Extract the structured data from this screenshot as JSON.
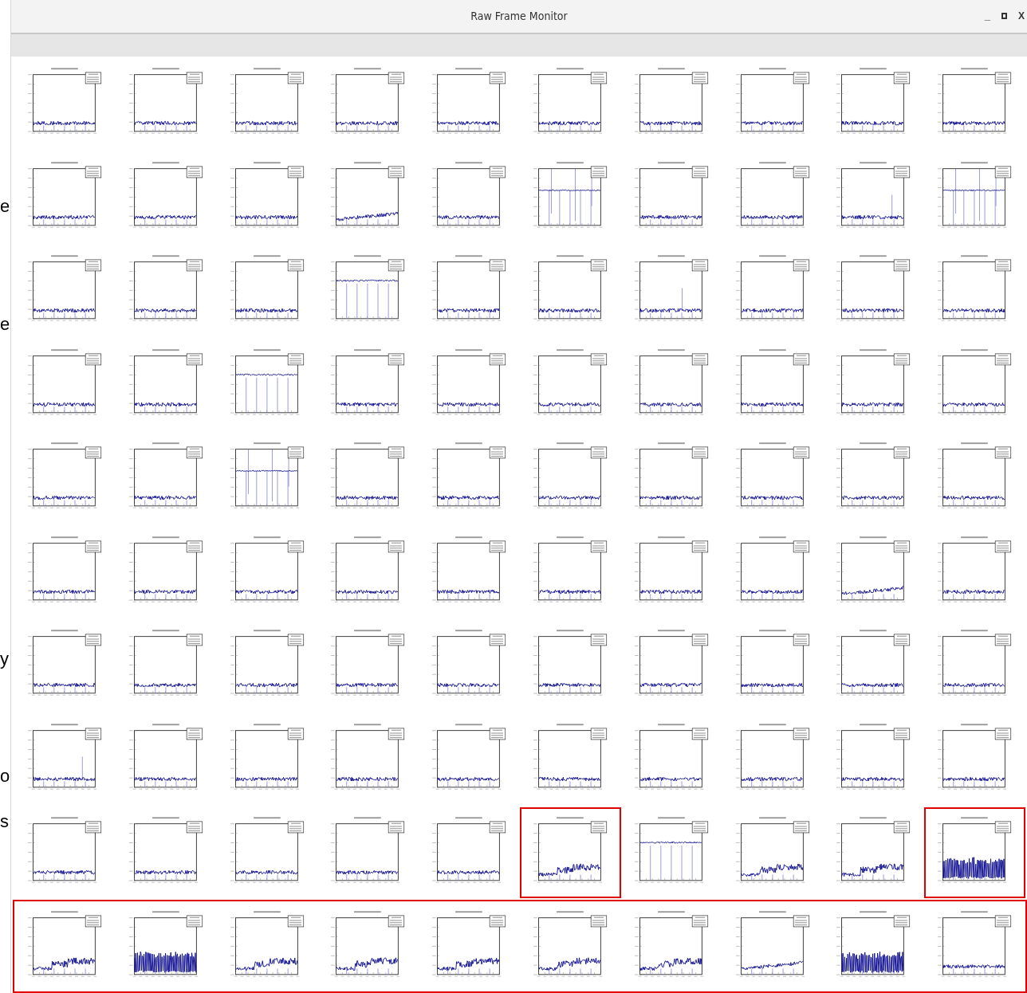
{
  "background_text": [
    {
      "text": "e"
    },
    {
      "text": "e"
    },
    {
      "text": "y"
    },
    {
      "text": "o"
    },
    {
      "text": "s"
    }
  ],
  "window": {
    "title": "Raw Frame Monitor",
    "controls": [
      {
        "kind": "minimize",
        "label": "_"
      },
      {
        "kind": "maximize"
      },
      {
        "kind": "close",
        "label": "X"
      }
    ]
  },
  "plots": {
    "rows": [
      {
        "highlighted": false,
        "cells": [
          {
            "kind": "flat",
            "highlighted": false
          },
          {
            "kind": "flat",
            "highlighted": false
          },
          {
            "kind": "flat",
            "highlighted": false
          },
          {
            "kind": "flat",
            "highlighted": false
          },
          {
            "kind": "flat",
            "highlighted": false
          },
          {
            "kind": "flat",
            "highlighted": false
          },
          {
            "kind": "flat",
            "highlighted": false
          },
          {
            "kind": "flat",
            "highlighted": false
          },
          {
            "kind": "flat",
            "highlighted": false
          },
          {
            "kind": "flat",
            "highlighted": false
          }
        ]
      },
      {
        "highlighted": false,
        "cells": [
          {
            "kind": "flat",
            "highlighted": false
          },
          {
            "kind": "flat",
            "highlighted": false
          },
          {
            "kind": "flat",
            "highlighted": false
          },
          {
            "kind": "ramp",
            "highlighted": false
          },
          {
            "kind": "flat",
            "highlighted": false
          },
          {
            "kind": "dips",
            "highlighted": false
          },
          {
            "kind": "flat",
            "highlighted": false
          },
          {
            "kind": "flat",
            "highlighted": false
          },
          {
            "kind": "spike",
            "highlighted": false
          },
          {
            "kind": "dips",
            "highlighted": false
          }
        ]
      },
      {
        "highlighted": false,
        "cells": [
          {
            "kind": "flat",
            "highlighted": false
          },
          {
            "kind": "flat",
            "highlighted": false
          },
          {
            "kind": "flat",
            "highlighted": false
          },
          {
            "kind": "high",
            "highlighted": false
          },
          {
            "kind": "flat",
            "highlighted": false
          },
          {
            "kind": "flat",
            "highlighted": false
          },
          {
            "kind": "spike",
            "highlighted": false
          },
          {
            "kind": "flat",
            "highlighted": false
          },
          {
            "kind": "flat",
            "highlighted": false
          },
          {
            "kind": "flat",
            "highlighted": false
          }
        ]
      },
      {
        "highlighted": false,
        "cells": [
          {
            "kind": "flat",
            "highlighted": false
          },
          {
            "kind": "flat",
            "highlighted": false
          },
          {
            "kind": "high",
            "highlighted": false
          },
          {
            "kind": "flat",
            "highlighted": false
          },
          {
            "kind": "flat",
            "highlighted": false
          },
          {
            "kind": "flat",
            "highlighted": false
          },
          {
            "kind": "flat",
            "highlighted": false
          },
          {
            "kind": "flat",
            "highlighted": false
          },
          {
            "kind": "flat",
            "highlighted": false
          },
          {
            "kind": "flat",
            "highlighted": false
          }
        ]
      },
      {
        "highlighted": false,
        "cells": [
          {
            "kind": "flat",
            "highlighted": false
          },
          {
            "kind": "flat",
            "highlighted": false
          },
          {
            "kind": "dips",
            "highlighted": false
          },
          {
            "kind": "flat",
            "highlighted": false
          },
          {
            "kind": "flat",
            "highlighted": false
          },
          {
            "kind": "flat",
            "highlighted": false
          },
          {
            "kind": "flat",
            "highlighted": false
          },
          {
            "kind": "flat",
            "highlighted": false
          },
          {
            "kind": "flat",
            "highlighted": false
          },
          {
            "kind": "flat",
            "highlighted": false
          }
        ]
      },
      {
        "highlighted": false,
        "cells": [
          {
            "kind": "flat",
            "highlighted": false
          },
          {
            "kind": "flat",
            "highlighted": false
          },
          {
            "kind": "flat",
            "highlighted": false
          },
          {
            "kind": "flat",
            "highlighted": false
          },
          {
            "kind": "flat",
            "highlighted": false
          },
          {
            "kind": "flat",
            "highlighted": false
          },
          {
            "kind": "flat",
            "highlighted": false
          },
          {
            "kind": "flat",
            "highlighted": false
          },
          {
            "kind": "ramp",
            "highlighted": false
          },
          {
            "kind": "flat",
            "highlighted": false
          }
        ]
      },
      {
        "highlighted": false,
        "cells": [
          {
            "kind": "flat",
            "highlighted": false
          },
          {
            "kind": "flat",
            "highlighted": false
          },
          {
            "kind": "flat",
            "highlighted": false
          },
          {
            "kind": "flat",
            "highlighted": false
          },
          {
            "kind": "flat",
            "highlighted": false
          },
          {
            "kind": "flat",
            "highlighted": false
          },
          {
            "kind": "flat",
            "highlighted": false
          },
          {
            "kind": "flat",
            "highlighted": false
          },
          {
            "kind": "flat",
            "highlighted": false
          },
          {
            "kind": "flat",
            "highlighted": false
          }
        ]
      },
      {
        "highlighted": false,
        "cells": [
          {
            "kind": "spike",
            "highlighted": false
          },
          {
            "kind": "flat",
            "highlighted": false
          },
          {
            "kind": "flat",
            "highlighted": false
          },
          {
            "kind": "flat",
            "highlighted": false
          },
          {
            "kind": "flat",
            "highlighted": false
          },
          {
            "kind": "flat",
            "highlighted": false
          },
          {
            "kind": "flat",
            "highlighted": false
          },
          {
            "kind": "flat",
            "highlighted": false
          },
          {
            "kind": "flat",
            "highlighted": false
          },
          {
            "kind": "flat",
            "highlighted": false
          }
        ]
      },
      {
        "highlighted": false,
        "cells": [
          {
            "kind": "flat",
            "highlighted": false
          },
          {
            "kind": "flat",
            "highlighted": false
          },
          {
            "kind": "flat",
            "highlighted": false
          },
          {
            "kind": "flat",
            "highlighted": false
          },
          {
            "kind": "flat",
            "highlighted": false
          },
          {
            "kind": "step",
            "highlighted": true
          },
          {
            "kind": "high",
            "highlighted": false
          },
          {
            "kind": "step",
            "highlighted": false
          },
          {
            "kind": "step",
            "highlighted": false
          },
          {
            "kind": "burst",
            "highlighted": true
          }
        ]
      },
      {
        "highlighted": true,
        "cells": [
          {
            "kind": "step",
            "highlighted": false
          },
          {
            "kind": "burst",
            "highlighted": false
          },
          {
            "kind": "step",
            "highlighted": false
          },
          {
            "kind": "step",
            "highlighted": false
          },
          {
            "kind": "step",
            "highlighted": false
          },
          {
            "kind": "step",
            "highlighted": false
          },
          {
            "kind": "step",
            "highlighted": false
          },
          {
            "kind": "ramp",
            "highlighted": false
          },
          {
            "kind": "burst",
            "highlighted": false
          },
          {
            "kind": "flat",
            "highlighted": false
          }
        ]
      }
    ]
  }
}
